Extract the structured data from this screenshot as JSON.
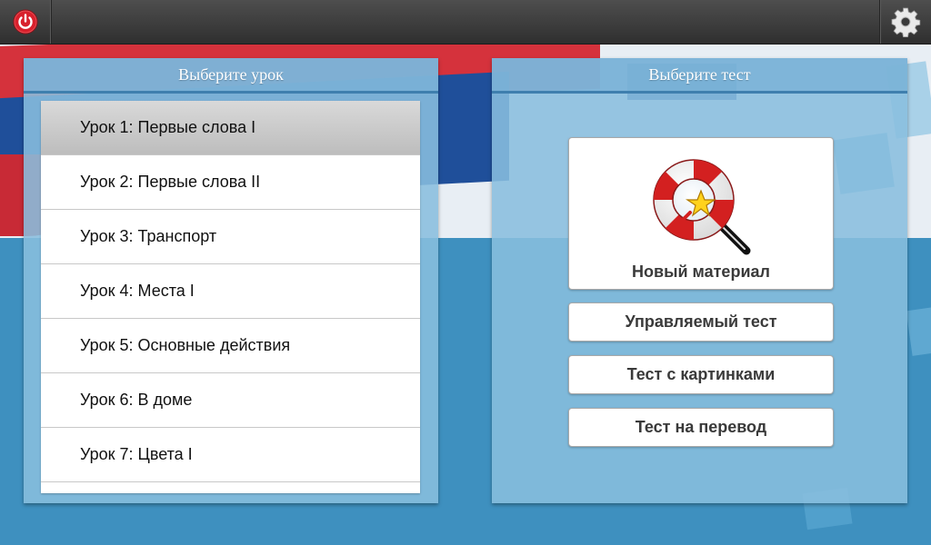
{
  "topbar": {
    "power_icon": "power-icon",
    "settings_icon": "gear-icon"
  },
  "lessons_panel": {
    "title": "Выберите урок",
    "items": [
      {
        "label": "Урок 1: Первые слова I",
        "selected": true
      },
      {
        "label": "Урок 2: Первые слова II",
        "selected": false
      },
      {
        "label": "Урок 3: Транспорт",
        "selected": false
      },
      {
        "label": "Урок 4: Места I",
        "selected": false
      },
      {
        "label": "Урок 5: Основные действия",
        "selected": false
      },
      {
        "label": "Урок 6: В доме",
        "selected": false
      },
      {
        "label": "Урок 7: Цвета I",
        "selected": false
      }
    ]
  },
  "tests_panel": {
    "title": "Выберите тест",
    "new_material": {
      "label": "Новый материал",
      "icon": "lifebuoy-magnifier-icon"
    },
    "guided_test": {
      "label": "Управляемый тест"
    },
    "picture_test": {
      "label": "Тест с картинками"
    },
    "translation_test": {
      "label": "Тест на перевод"
    }
  },
  "colors": {
    "topbar": "#3a3a3a",
    "panel": "#89bede",
    "power_red": "#d8202c",
    "selected_item": "#c8c8c8"
  }
}
